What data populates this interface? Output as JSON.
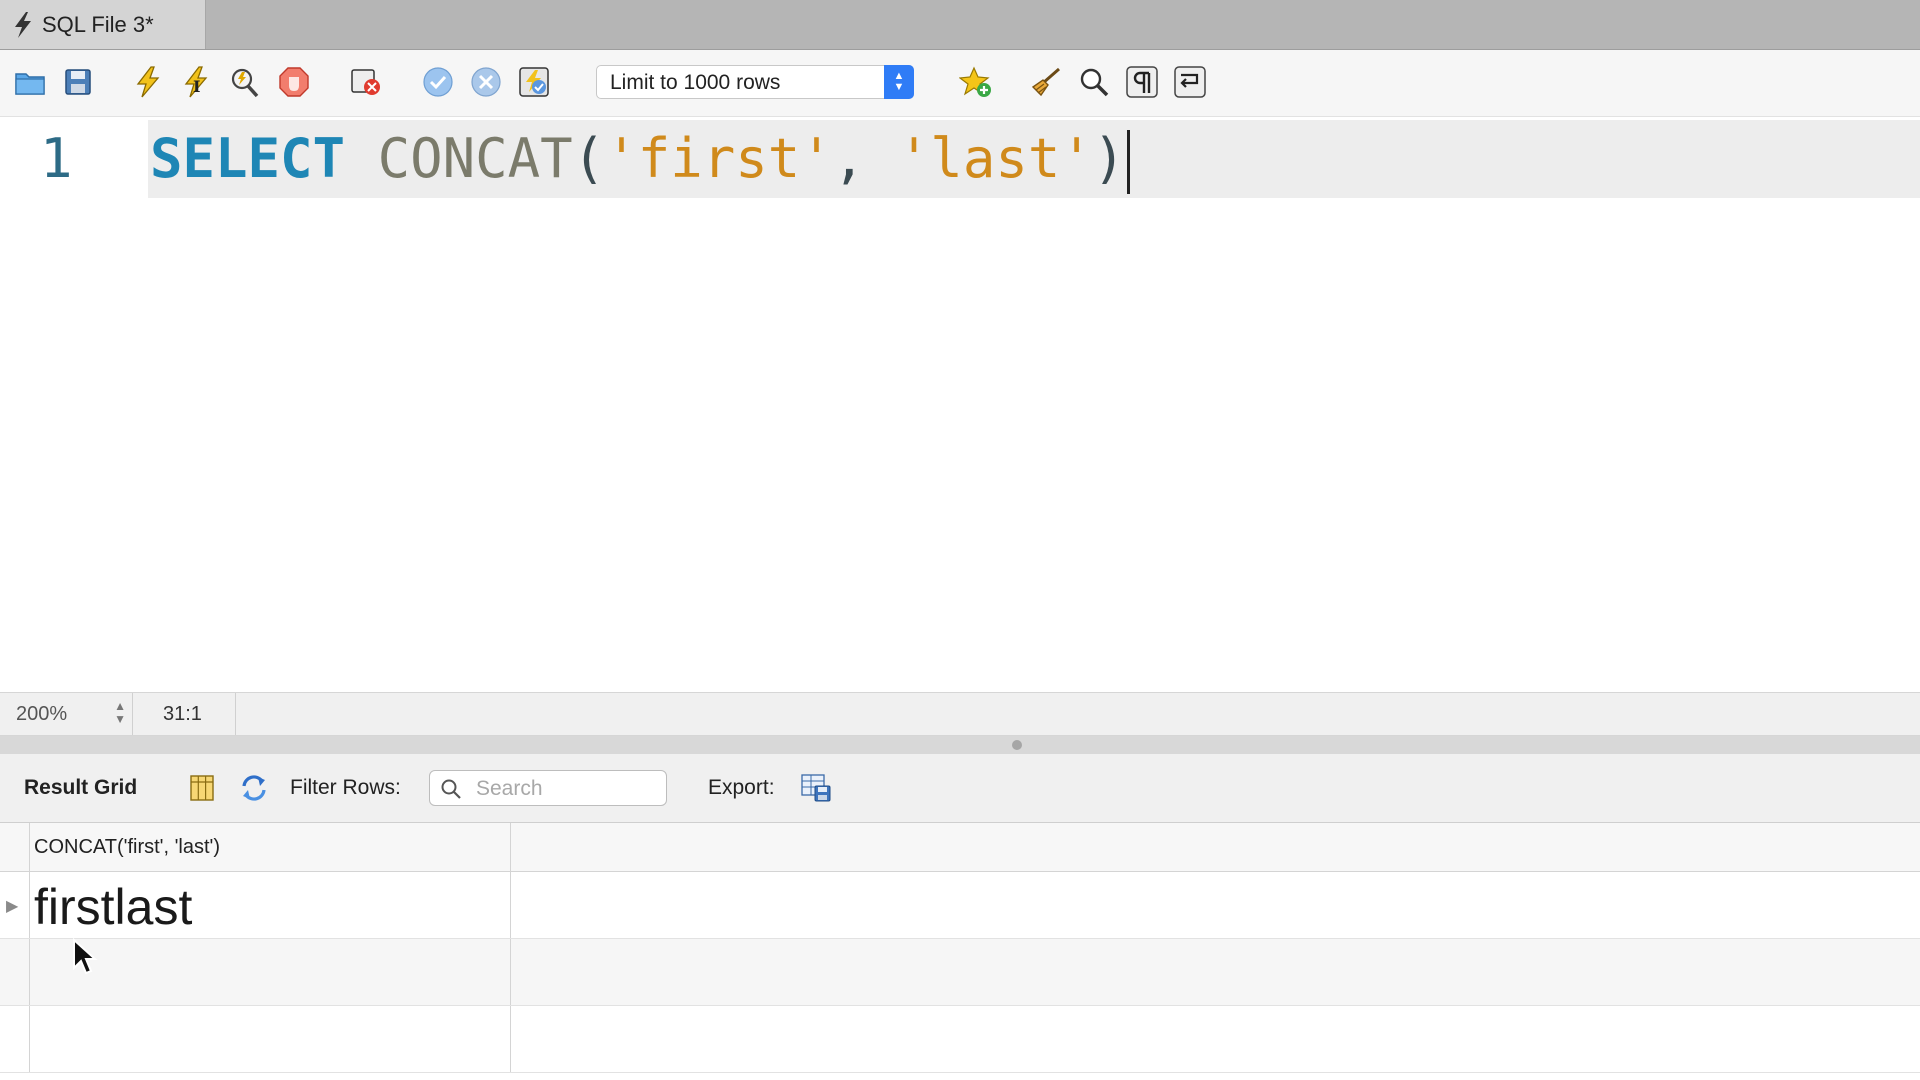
{
  "tab": {
    "title": "SQL File 3*"
  },
  "toolbar": {
    "icons": [
      "open-folder-icon",
      "save-icon",
      "execute-icon",
      "execute-current-icon",
      "explain-icon",
      "stop-icon",
      "stop-on-error-icon",
      "commit-icon",
      "rollback-icon",
      "autocommit-icon",
      "add-snippet-icon",
      "beautify-icon",
      "find-icon",
      "invisible-chars-icon",
      "wrap-icon"
    ],
    "limit_select": {
      "value": "Limit to 1000 rows"
    }
  },
  "editor": {
    "line_number": "1",
    "tokens": {
      "keyword": "SELECT",
      "function": "CONCAT",
      "open_paren": "(",
      "str1": "'first'",
      "comma": ",",
      "str2": "'last'",
      "close_paren": ")"
    },
    "colors": {
      "keyword": "#1e86b5",
      "string": "#d08a1b",
      "function": "#7b7b6b"
    }
  },
  "status": {
    "zoom": "200%",
    "cursor_position": "31:1"
  },
  "result_toolbar": {
    "title": "Result Grid",
    "filter_label": "Filter Rows:",
    "search_placeholder": "Search",
    "export_label": "Export:"
  },
  "grid": {
    "columns": [
      "CONCAT('first', 'last')"
    ],
    "rows": [
      [
        "firstlast"
      ]
    ],
    "row_marker": "▶"
  }
}
